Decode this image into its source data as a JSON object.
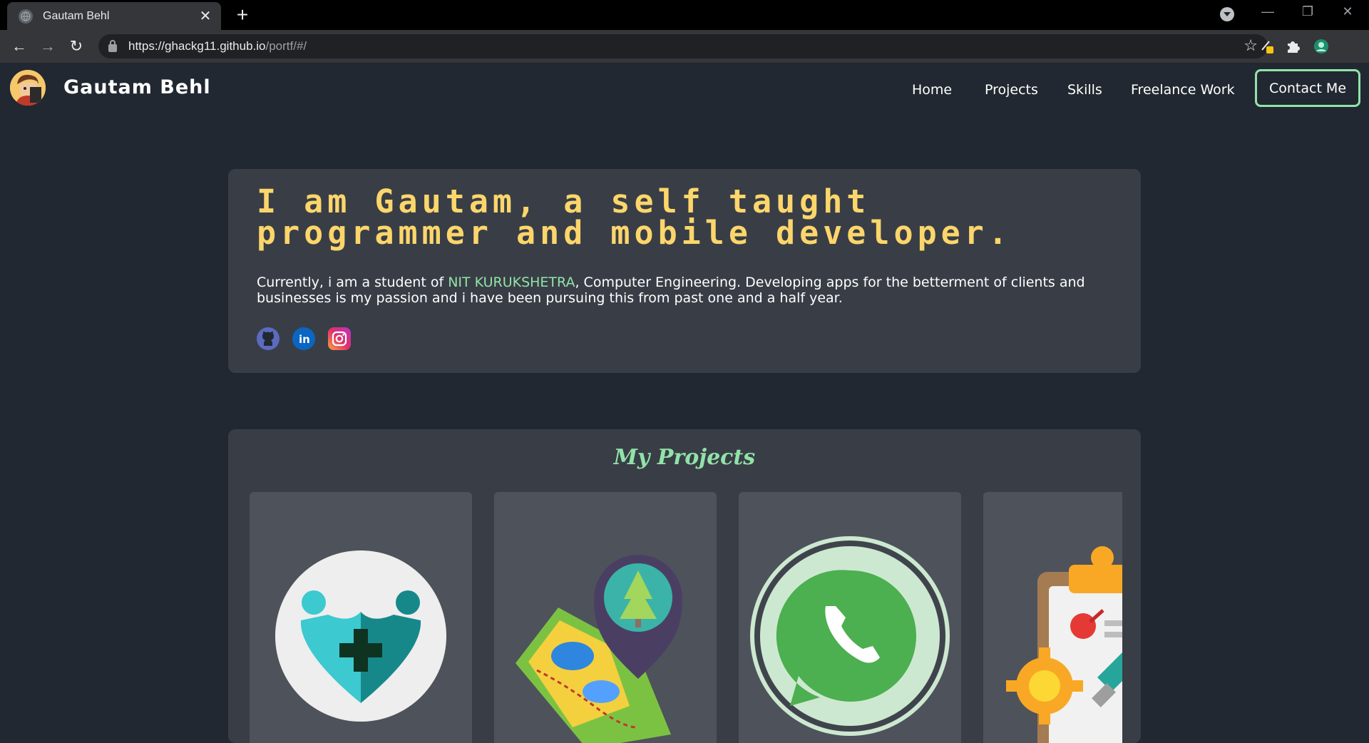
{
  "browser": {
    "tab_title": "Gautam Behl",
    "url_host": "https://ghackg11.github.io",
    "url_path": "/portf/#/"
  },
  "nav": {
    "brand": "Gautam Behl",
    "links": [
      "Home",
      "Projects",
      "Skills",
      "Freelance Work"
    ],
    "contact_label": "Contact Me"
  },
  "hero": {
    "heading": "I am Gautam, a self taught programmer and mobile developer.",
    "text_before": "Currently, i am a student of ",
    "highlight": "NIT KURUKSHETRA",
    "text_after": ", Computer Engineering. Developing apps for the betterment of clients and businesses is my passion and i have been pursuing this from past one and a half year.",
    "socials": [
      "github-icon",
      "linkedin-icon",
      "instagram-icon"
    ]
  },
  "projects": {
    "title": "My Projects",
    "cards": [
      "healthcare-icon",
      "map-pin-tree-icon",
      "whatsapp-icon",
      "clipboard-gear-icon"
    ]
  },
  "colors": {
    "background": "#222831",
    "panel": "#393e46",
    "card": "#4e525b",
    "heading_yellow": "#fcd66b",
    "accent_green": "#92e3a9"
  }
}
